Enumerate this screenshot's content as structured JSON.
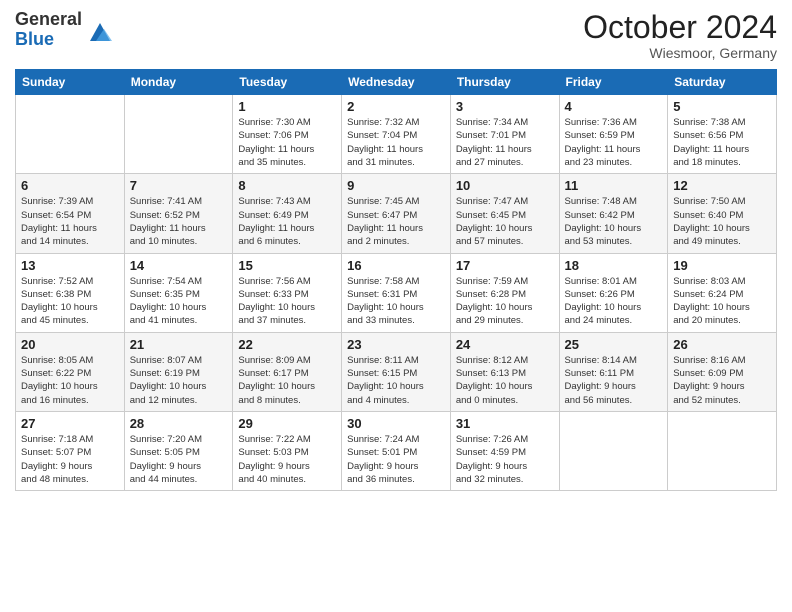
{
  "logo": {
    "general": "General",
    "blue": "Blue"
  },
  "header": {
    "month": "October 2024",
    "location": "Wiesmoor, Germany"
  },
  "weekdays": [
    "Sunday",
    "Monday",
    "Tuesday",
    "Wednesday",
    "Thursday",
    "Friday",
    "Saturday"
  ],
  "weeks": [
    [
      {
        "day": "",
        "info": ""
      },
      {
        "day": "",
        "info": ""
      },
      {
        "day": "1",
        "info": "Sunrise: 7:30 AM\nSunset: 7:06 PM\nDaylight: 11 hours\nand 35 minutes."
      },
      {
        "day": "2",
        "info": "Sunrise: 7:32 AM\nSunset: 7:04 PM\nDaylight: 11 hours\nand 31 minutes."
      },
      {
        "day": "3",
        "info": "Sunrise: 7:34 AM\nSunset: 7:01 PM\nDaylight: 11 hours\nand 27 minutes."
      },
      {
        "day": "4",
        "info": "Sunrise: 7:36 AM\nSunset: 6:59 PM\nDaylight: 11 hours\nand 23 minutes."
      },
      {
        "day": "5",
        "info": "Sunrise: 7:38 AM\nSunset: 6:56 PM\nDaylight: 11 hours\nand 18 minutes."
      }
    ],
    [
      {
        "day": "6",
        "info": "Sunrise: 7:39 AM\nSunset: 6:54 PM\nDaylight: 11 hours\nand 14 minutes."
      },
      {
        "day": "7",
        "info": "Sunrise: 7:41 AM\nSunset: 6:52 PM\nDaylight: 11 hours\nand 10 minutes."
      },
      {
        "day": "8",
        "info": "Sunrise: 7:43 AM\nSunset: 6:49 PM\nDaylight: 11 hours\nand 6 minutes."
      },
      {
        "day": "9",
        "info": "Sunrise: 7:45 AM\nSunset: 6:47 PM\nDaylight: 11 hours\nand 2 minutes."
      },
      {
        "day": "10",
        "info": "Sunrise: 7:47 AM\nSunset: 6:45 PM\nDaylight: 10 hours\nand 57 minutes."
      },
      {
        "day": "11",
        "info": "Sunrise: 7:48 AM\nSunset: 6:42 PM\nDaylight: 10 hours\nand 53 minutes."
      },
      {
        "day": "12",
        "info": "Sunrise: 7:50 AM\nSunset: 6:40 PM\nDaylight: 10 hours\nand 49 minutes."
      }
    ],
    [
      {
        "day": "13",
        "info": "Sunrise: 7:52 AM\nSunset: 6:38 PM\nDaylight: 10 hours\nand 45 minutes."
      },
      {
        "day": "14",
        "info": "Sunrise: 7:54 AM\nSunset: 6:35 PM\nDaylight: 10 hours\nand 41 minutes."
      },
      {
        "day": "15",
        "info": "Sunrise: 7:56 AM\nSunset: 6:33 PM\nDaylight: 10 hours\nand 37 minutes."
      },
      {
        "day": "16",
        "info": "Sunrise: 7:58 AM\nSunset: 6:31 PM\nDaylight: 10 hours\nand 33 minutes."
      },
      {
        "day": "17",
        "info": "Sunrise: 7:59 AM\nSunset: 6:28 PM\nDaylight: 10 hours\nand 29 minutes."
      },
      {
        "day": "18",
        "info": "Sunrise: 8:01 AM\nSunset: 6:26 PM\nDaylight: 10 hours\nand 24 minutes."
      },
      {
        "day": "19",
        "info": "Sunrise: 8:03 AM\nSunset: 6:24 PM\nDaylight: 10 hours\nand 20 minutes."
      }
    ],
    [
      {
        "day": "20",
        "info": "Sunrise: 8:05 AM\nSunset: 6:22 PM\nDaylight: 10 hours\nand 16 minutes."
      },
      {
        "day": "21",
        "info": "Sunrise: 8:07 AM\nSunset: 6:19 PM\nDaylight: 10 hours\nand 12 minutes."
      },
      {
        "day": "22",
        "info": "Sunrise: 8:09 AM\nSunset: 6:17 PM\nDaylight: 10 hours\nand 8 minutes."
      },
      {
        "day": "23",
        "info": "Sunrise: 8:11 AM\nSunset: 6:15 PM\nDaylight: 10 hours\nand 4 minutes."
      },
      {
        "day": "24",
        "info": "Sunrise: 8:12 AM\nSunset: 6:13 PM\nDaylight: 10 hours\nand 0 minutes."
      },
      {
        "day": "25",
        "info": "Sunrise: 8:14 AM\nSunset: 6:11 PM\nDaylight: 9 hours\nand 56 minutes."
      },
      {
        "day": "26",
        "info": "Sunrise: 8:16 AM\nSunset: 6:09 PM\nDaylight: 9 hours\nand 52 minutes."
      }
    ],
    [
      {
        "day": "27",
        "info": "Sunrise: 7:18 AM\nSunset: 5:07 PM\nDaylight: 9 hours\nand 48 minutes."
      },
      {
        "day": "28",
        "info": "Sunrise: 7:20 AM\nSunset: 5:05 PM\nDaylight: 9 hours\nand 44 minutes."
      },
      {
        "day": "29",
        "info": "Sunrise: 7:22 AM\nSunset: 5:03 PM\nDaylight: 9 hours\nand 40 minutes."
      },
      {
        "day": "30",
        "info": "Sunrise: 7:24 AM\nSunset: 5:01 PM\nDaylight: 9 hours\nand 36 minutes."
      },
      {
        "day": "31",
        "info": "Sunrise: 7:26 AM\nSunset: 4:59 PM\nDaylight: 9 hours\nand 32 minutes."
      },
      {
        "day": "",
        "info": ""
      },
      {
        "day": "",
        "info": ""
      }
    ]
  ]
}
